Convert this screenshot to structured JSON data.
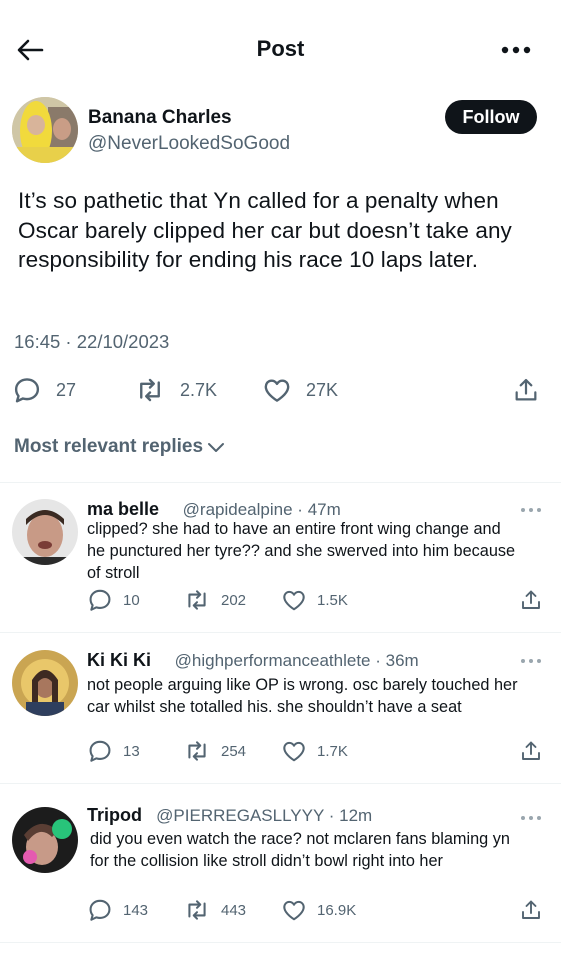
{
  "header": {
    "title": "Post"
  },
  "post": {
    "author_name": "Banana Charles",
    "author_handle": "@NeverLookedSoGood",
    "follow_label": "Follow",
    "text": "It’s so pathetic that Yn called for a penalty when Oscar barely clipped her car but doesn’t take any responsibility for ending his race 10 laps later.",
    "time": "16:45",
    "date": "22/10/2023",
    "replies_count": "27",
    "reposts_count": "2.7K",
    "likes_count": "27K"
  },
  "replies_filter": {
    "label": "Most relevant replies"
  },
  "replies": [
    {
      "name": "ma belle",
      "handle": "@rapidealpine",
      "age": "47m",
      "text": "clipped? she had to have an entire front wing change and he punctured her tyre?? and she swerved into him because of stroll",
      "replies": "10",
      "reposts": "202",
      "likes": "1.5K"
    },
    {
      "name": "Ki Ki Ki",
      "handle": "@highperformanceathlete",
      "age": "36m",
      "text": "not people arguing like OP is wrong. osc barely touched her car whilst she totalled his. she shouldn’t have a seat",
      "replies": "13",
      "reposts": "254",
      "likes": "1.7K"
    },
    {
      "name": "Tripod",
      "handle": "@PIERREGASLLYYY",
      "age": "12m",
      "text": "did you even watch the race? not mclaren fans blaming yn for the collision like stroll didn’t bowl right into her",
      "replies": "143",
      "reposts": "443",
      "likes": "16.9K"
    }
  ],
  "colors": {
    "text": "#0f1419",
    "secondary": "#536471",
    "divider": "#eff3f4",
    "follow_bg": "#0f1419"
  },
  "icons": [
    "back-arrow-icon",
    "more-icon",
    "reply-icon",
    "repost-icon",
    "like-icon",
    "share-icon",
    "chevron-down-icon"
  ]
}
